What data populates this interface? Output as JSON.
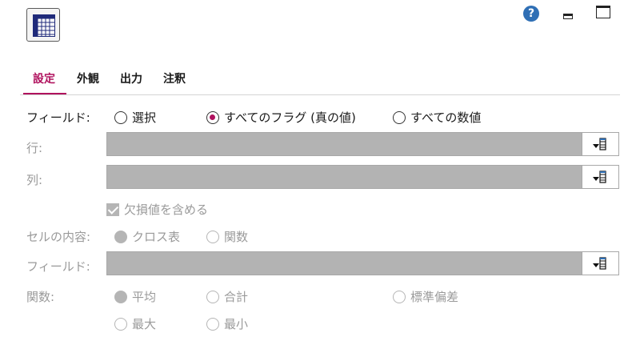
{
  "tabs": [
    "設定",
    "外観",
    "出力",
    "注釈"
  ],
  "field_mode": {
    "label": "フィールド:",
    "options": [
      "選択",
      "すべてのフラグ (真の値)",
      "すべての数値"
    ],
    "selected": "すべてのフラグ (真の値)"
  },
  "rows": {
    "label": "行:",
    "value": ""
  },
  "columns": {
    "label": "列:",
    "value": ""
  },
  "include_missing": {
    "label": "欠損値を含める",
    "checked": true
  },
  "cell_contents": {
    "label": "セルの内容:",
    "options": [
      "クロス表",
      "関数"
    ],
    "selected": "クロス表"
  },
  "function_field": {
    "label": "フィールド:",
    "value": ""
  },
  "function": {
    "label": "関数:",
    "options": [
      "平均",
      "合計",
      "標準偏差",
      "最大",
      "最小"
    ],
    "selected": "平均"
  },
  "icons": {
    "app": "table-grid-icon",
    "help": "help-icon",
    "help_glyph": "?",
    "minimize": "minimize-icon",
    "maximize": "maximize-icon",
    "picker": "field-picker-icon"
  },
  "colors": {
    "accent": "#b0125e",
    "help": "#2f6fb5",
    "disabled_field": "#b3b3b3"
  }
}
